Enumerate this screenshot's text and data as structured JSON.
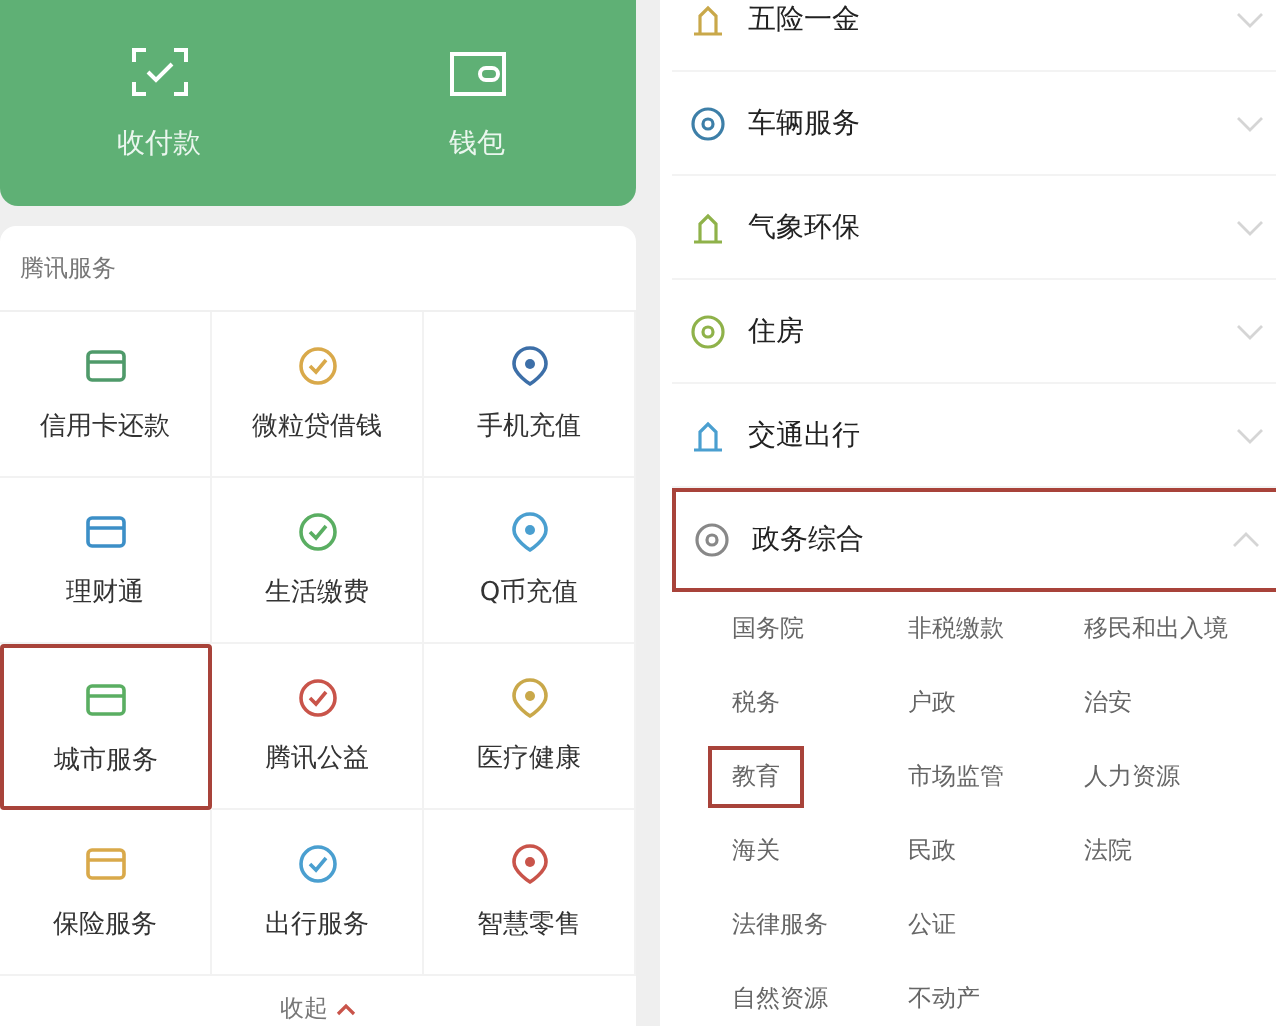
{
  "wallet_header": {
    "items": [
      {
        "label": "收付款"
      },
      {
        "label": "钱包"
      }
    ]
  },
  "tencent_services": {
    "title": "腾讯服务",
    "items": [
      {
        "label": "信用卡还款",
        "highlighted": false
      },
      {
        "label": "微粒贷借钱",
        "highlighted": false
      },
      {
        "label": "手机充值",
        "highlighted": false
      },
      {
        "label": "理财通",
        "highlighted": false
      },
      {
        "label": "生活缴费",
        "highlighted": false
      },
      {
        "label": "Q币充值",
        "highlighted": false
      },
      {
        "label": "城市服务",
        "highlighted": true
      },
      {
        "label": "腾讯公益",
        "highlighted": false
      },
      {
        "label": "医疗健康",
        "highlighted": false
      },
      {
        "label": "保险服务",
        "highlighted": false
      },
      {
        "label": "出行服务",
        "highlighted": false
      },
      {
        "label": "智慧零售",
        "highlighted": false
      }
    ],
    "collapse_label": "收起"
  },
  "city_categories": [
    {
      "label": "五险一金",
      "expanded": false,
      "highlighted": false
    },
    {
      "label": "车辆服务",
      "expanded": false,
      "highlighted": false
    },
    {
      "label": "气象环保",
      "expanded": false,
      "highlighted": false
    },
    {
      "label": "住房",
      "expanded": false,
      "highlighted": false
    },
    {
      "label": "交通出行",
      "expanded": false,
      "highlighted": false
    },
    {
      "label": "政务综合",
      "expanded": true,
      "highlighted": true,
      "child_rows": [
        [
          {
            "label": "国务院",
            "highlighted": false
          },
          {
            "label": "非税缴款",
            "highlighted": false
          },
          {
            "label": "移民和出入境",
            "highlighted": false
          }
        ],
        [
          {
            "label": "税务",
            "highlighted": false
          },
          {
            "label": "户政",
            "highlighted": false
          },
          {
            "label": "治安",
            "highlighted": false
          }
        ],
        [
          {
            "label": "教育",
            "highlighted": true
          },
          {
            "label": "市场监管",
            "highlighted": false
          },
          {
            "label": "人力资源",
            "highlighted": false
          }
        ],
        [
          {
            "label": "海关",
            "highlighted": false
          },
          {
            "label": "民政",
            "highlighted": false
          },
          {
            "label": "法院",
            "highlighted": false
          }
        ],
        [
          {
            "label": "法律服务",
            "highlighted": false
          },
          {
            "label": "公证",
            "highlighted": false
          }
        ],
        [
          {
            "label": "自然资源",
            "highlighted": false
          },
          {
            "label": "不动产",
            "highlighted": false
          }
        ]
      ]
    }
  ]
}
